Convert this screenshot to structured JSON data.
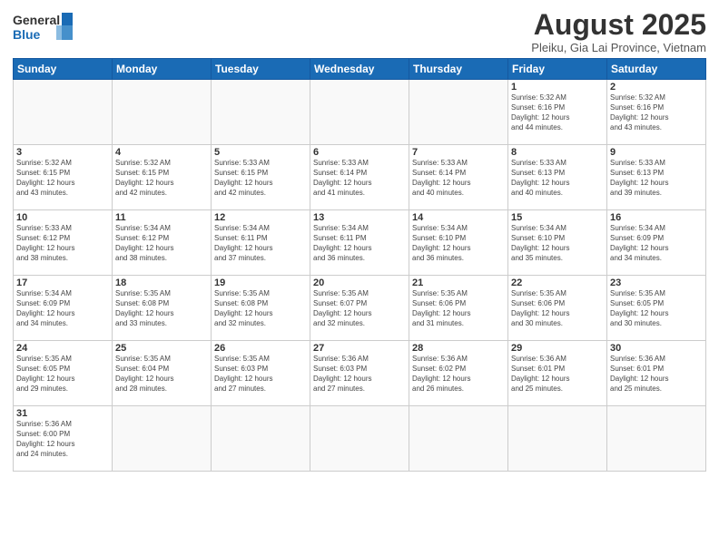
{
  "header": {
    "logo_general": "General",
    "logo_blue": "Blue",
    "month_title": "August 2025",
    "subtitle": "Pleiku, Gia Lai Province, Vietnam"
  },
  "weekdays": [
    "Sunday",
    "Monday",
    "Tuesday",
    "Wednesday",
    "Thursday",
    "Friday",
    "Saturday"
  ],
  "weeks": [
    [
      {
        "date": "",
        "info": ""
      },
      {
        "date": "",
        "info": ""
      },
      {
        "date": "",
        "info": ""
      },
      {
        "date": "",
        "info": ""
      },
      {
        "date": "",
        "info": ""
      },
      {
        "date": "1",
        "info": "Sunrise: 5:32 AM\nSunset: 6:16 PM\nDaylight: 12 hours\nand 44 minutes."
      },
      {
        "date": "2",
        "info": "Sunrise: 5:32 AM\nSunset: 6:16 PM\nDaylight: 12 hours\nand 43 minutes."
      }
    ],
    [
      {
        "date": "3",
        "info": "Sunrise: 5:32 AM\nSunset: 6:15 PM\nDaylight: 12 hours\nand 43 minutes."
      },
      {
        "date": "4",
        "info": "Sunrise: 5:32 AM\nSunset: 6:15 PM\nDaylight: 12 hours\nand 42 minutes."
      },
      {
        "date": "5",
        "info": "Sunrise: 5:33 AM\nSunset: 6:15 PM\nDaylight: 12 hours\nand 42 minutes."
      },
      {
        "date": "6",
        "info": "Sunrise: 5:33 AM\nSunset: 6:14 PM\nDaylight: 12 hours\nand 41 minutes."
      },
      {
        "date": "7",
        "info": "Sunrise: 5:33 AM\nSunset: 6:14 PM\nDaylight: 12 hours\nand 40 minutes."
      },
      {
        "date": "8",
        "info": "Sunrise: 5:33 AM\nSunset: 6:13 PM\nDaylight: 12 hours\nand 40 minutes."
      },
      {
        "date": "9",
        "info": "Sunrise: 5:33 AM\nSunset: 6:13 PM\nDaylight: 12 hours\nand 39 minutes."
      }
    ],
    [
      {
        "date": "10",
        "info": "Sunrise: 5:33 AM\nSunset: 6:12 PM\nDaylight: 12 hours\nand 38 minutes."
      },
      {
        "date": "11",
        "info": "Sunrise: 5:34 AM\nSunset: 6:12 PM\nDaylight: 12 hours\nand 38 minutes."
      },
      {
        "date": "12",
        "info": "Sunrise: 5:34 AM\nSunset: 6:11 PM\nDaylight: 12 hours\nand 37 minutes."
      },
      {
        "date": "13",
        "info": "Sunrise: 5:34 AM\nSunset: 6:11 PM\nDaylight: 12 hours\nand 36 minutes."
      },
      {
        "date": "14",
        "info": "Sunrise: 5:34 AM\nSunset: 6:10 PM\nDaylight: 12 hours\nand 36 minutes."
      },
      {
        "date": "15",
        "info": "Sunrise: 5:34 AM\nSunset: 6:10 PM\nDaylight: 12 hours\nand 35 minutes."
      },
      {
        "date": "16",
        "info": "Sunrise: 5:34 AM\nSunset: 6:09 PM\nDaylight: 12 hours\nand 34 minutes."
      }
    ],
    [
      {
        "date": "17",
        "info": "Sunrise: 5:34 AM\nSunset: 6:09 PM\nDaylight: 12 hours\nand 34 minutes."
      },
      {
        "date": "18",
        "info": "Sunrise: 5:35 AM\nSunset: 6:08 PM\nDaylight: 12 hours\nand 33 minutes."
      },
      {
        "date": "19",
        "info": "Sunrise: 5:35 AM\nSunset: 6:08 PM\nDaylight: 12 hours\nand 32 minutes."
      },
      {
        "date": "20",
        "info": "Sunrise: 5:35 AM\nSunset: 6:07 PM\nDaylight: 12 hours\nand 32 minutes."
      },
      {
        "date": "21",
        "info": "Sunrise: 5:35 AM\nSunset: 6:06 PM\nDaylight: 12 hours\nand 31 minutes."
      },
      {
        "date": "22",
        "info": "Sunrise: 5:35 AM\nSunset: 6:06 PM\nDaylight: 12 hours\nand 30 minutes."
      },
      {
        "date": "23",
        "info": "Sunrise: 5:35 AM\nSunset: 6:05 PM\nDaylight: 12 hours\nand 30 minutes."
      }
    ],
    [
      {
        "date": "24",
        "info": "Sunrise: 5:35 AM\nSunset: 6:05 PM\nDaylight: 12 hours\nand 29 minutes."
      },
      {
        "date": "25",
        "info": "Sunrise: 5:35 AM\nSunset: 6:04 PM\nDaylight: 12 hours\nand 28 minutes."
      },
      {
        "date": "26",
        "info": "Sunrise: 5:35 AM\nSunset: 6:03 PM\nDaylight: 12 hours\nand 27 minutes."
      },
      {
        "date": "27",
        "info": "Sunrise: 5:36 AM\nSunset: 6:03 PM\nDaylight: 12 hours\nand 27 minutes."
      },
      {
        "date": "28",
        "info": "Sunrise: 5:36 AM\nSunset: 6:02 PM\nDaylight: 12 hours\nand 26 minutes."
      },
      {
        "date": "29",
        "info": "Sunrise: 5:36 AM\nSunset: 6:01 PM\nDaylight: 12 hours\nand 25 minutes."
      },
      {
        "date": "30",
        "info": "Sunrise: 5:36 AM\nSunset: 6:01 PM\nDaylight: 12 hours\nand 25 minutes."
      }
    ],
    [
      {
        "date": "31",
        "info": "Sunrise: 5:36 AM\nSunset: 6:00 PM\nDaylight: 12 hours\nand 24 minutes."
      },
      {
        "date": "",
        "info": ""
      },
      {
        "date": "",
        "info": ""
      },
      {
        "date": "",
        "info": ""
      },
      {
        "date": "",
        "info": ""
      },
      {
        "date": "",
        "info": ""
      },
      {
        "date": "",
        "info": ""
      }
    ]
  ]
}
